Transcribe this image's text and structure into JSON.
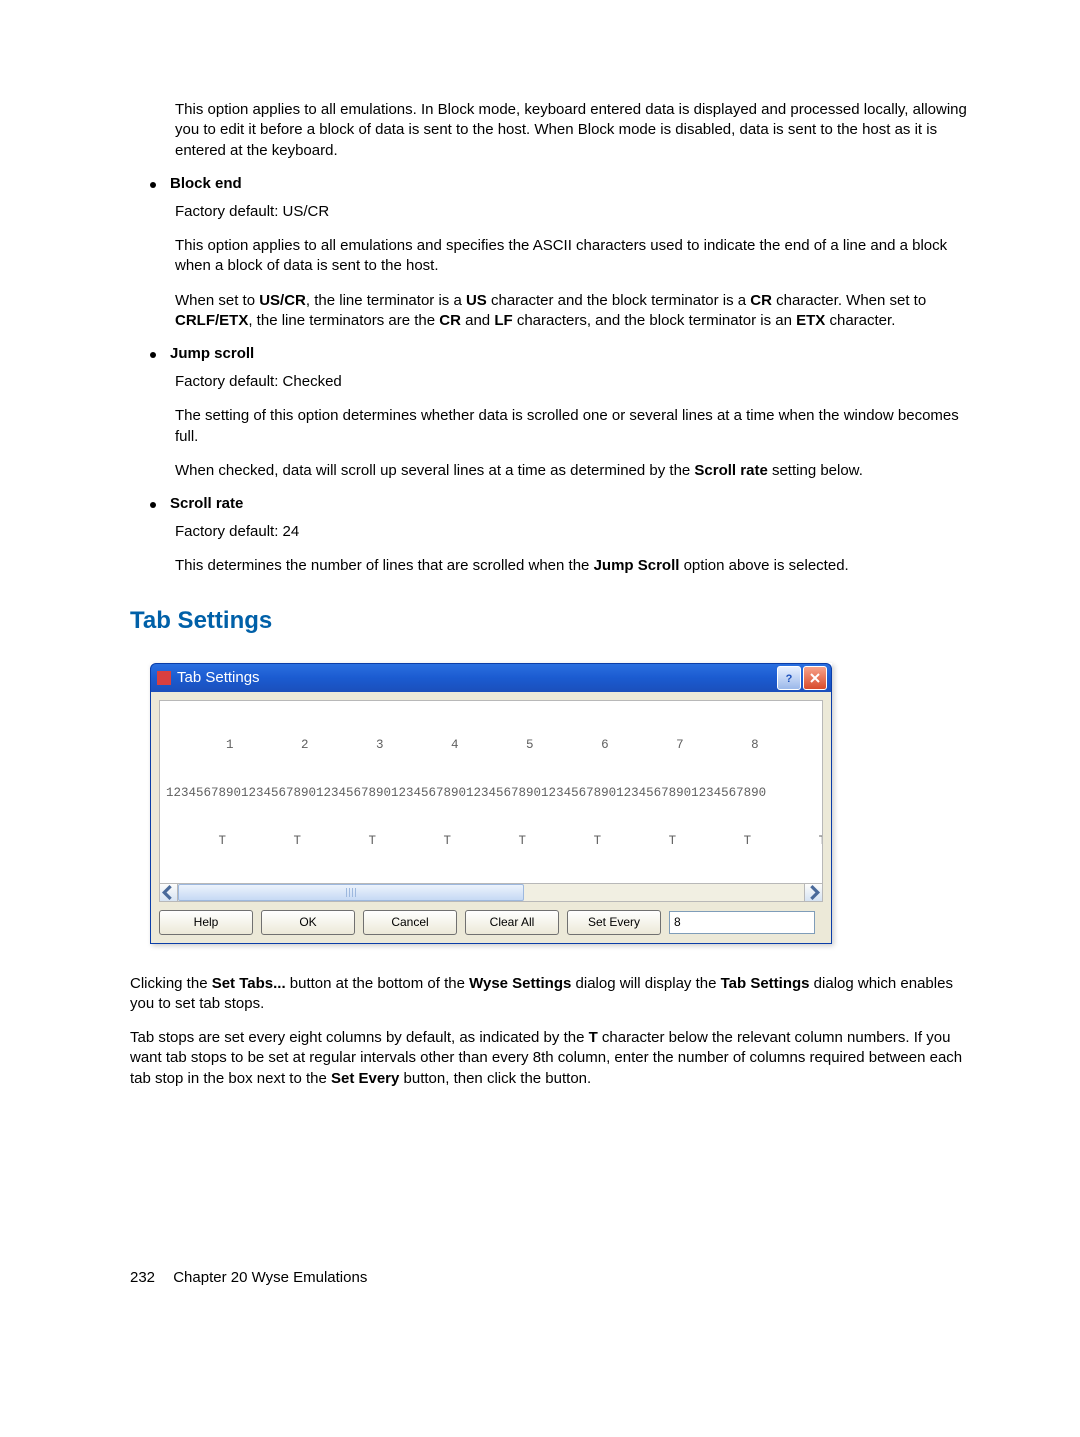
{
  "intro_para": "This option applies to all emulations. In Block mode, keyboard entered data is displayed and processed locally, allowing you to edit it before a block of data is sent to the host. When Block mode is disabled, data is sent to the host as it is entered at the keyboard.",
  "block_end": {
    "title": "Block end",
    "factory": "Factory default: US/CR",
    "p1": "This option applies to all emulations and specifies the ASCII characters used to indicate the end of a line and a block when a block of data is sent to the host.",
    "p2_a": "When set to ",
    "p2_b": "US/CR",
    "p2_c": ", the line terminator is a ",
    "p2_d": "US",
    "p2_e": " character and the block terminator is a ",
    "p2_f": "CR",
    "p2_g": " character. When set to ",
    "p2_h": "CRLF/ETX",
    "p2_i": ", the line terminators are the ",
    "p2_j": "CR",
    "p2_k": " and ",
    "p2_l": "LF",
    "p2_m": " characters, and the block terminator is an ",
    "p2_n": "ETX",
    "p2_o": " character."
  },
  "jump_scroll": {
    "title": "Jump scroll",
    "factory": "Factory default: Checked",
    "p1": "The setting of this option determines whether data is scrolled one or several lines at a time when the window becomes full.",
    "p2_a": "When checked, data will scroll up several lines at a time as determined by the ",
    "p2_b": "Scroll rate",
    "p2_c": " setting below."
  },
  "scroll_rate": {
    "title": "Scroll rate",
    "factory": "Factory default: 24",
    "p1_a": "This determines the number of lines that are scrolled when the ",
    "p1_b": "Jump Scroll",
    "p1_c": " option above is selected."
  },
  "section_heading": "Tab Settings",
  "dialog": {
    "title": "Tab Settings",
    "ruler_tens": "        1         2         3         4         5         6         7         8",
    "ruler_digits": "12345678901234567890123456789012345678901234567890123456789012345678901234567890",
    "ruler_tabs": "       T         T         T         T         T         T         T         T         T        ",
    "buttons": {
      "help": "Help",
      "ok": "OK",
      "cancel": "Cancel",
      "clear_all": "Clear All",
      "set_every": "Set Every"
    },
    "set_every_value": "8"
  },
  "after": {
    "p1_a": "Clicking the ",
    "p1_b": "Set Tabs...",
    "p1_c": " button at the bottom of the ",
    "p1_d": "Wyse Settings",
    "p1_e": " dialog will display the ",
    "p1_f": "Tab Settings",
    "p1_g": " dialog which enables you to set tab stops.",
    "p2_a": "Tab stops are set every eight columns by default, as indicated by the ",
    "p2_b": "T",
    "p2_c": " character below the relevant column numbers. If you want tab stops to be set at regular intervals other than every 8th column, enter the number of columns required between each tab stop in the box next to the ",
    "p2_d": "Set Every",
    "p2_e": " button, then click the button."
  },
  "footer": {
    "page": "232",
    "chapter": "Chapter 20   Wyse Emulations"
  }
}
